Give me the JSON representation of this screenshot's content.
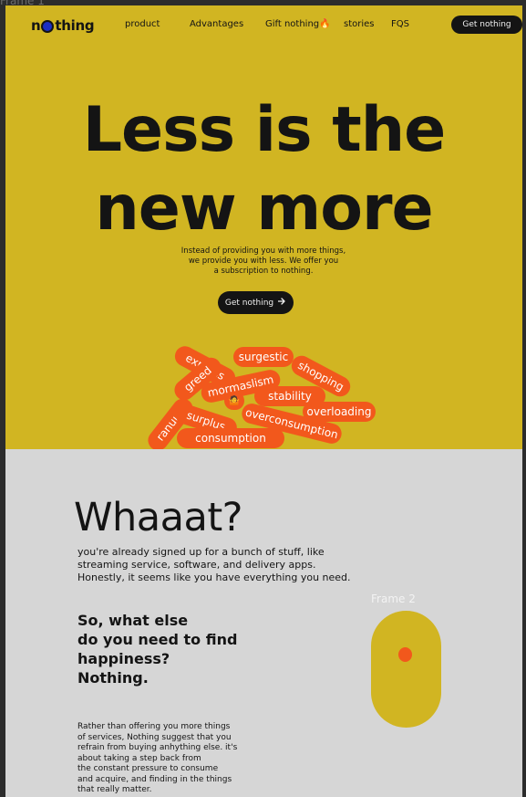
{
  "canvas": {
    "frame_label": "Frame 1"
  },
  "nav": {
    "logo": {
      "prefix": "n",
      "suffix": "thing"
    },
    "links": [
      "product",
      "Advantages",
      "Gift nothing🔥",
      "stories",
      "FQS"
    ],
    "cta": "Get nothing"
  },
  "hero": {
    "headline": [
      "Less is the",
      "new more"
    ],
    "subtext": [
      "Instead of providing you with more things,",
      "we provide you with less. We offer you",
      "a subscription to nothing."
    ],
    "cta": "Get nothing",
    "cta_icon": "arrow-right-icon",
    "tags": [
      "express",
      "surgestic",
      "greed",
      "mormaslism",
      "shopping",
      "stability",
      "surplus",
      "overloading",
      "ranuus",
      "overconsumption",
      "consumption",
      "🤷"
    ]
  },
  "section": {
    "title": "Whaaat?",
    "paragraph": [
      "you're already signed up for a bunch of stuff, like",
      "streaming service, software, and delivery apps.",
      "Honestly, it seems like you have everything you need."
    ],
    "question": [
      "So, what else",
      "do you need to find",
      "happiness?",
      "Nothing."
    ],
    "body": [
      "Rather than offering you more things",
      "of services, Nothing suggest that you",
      "refrain from buying anhything else. it's",
      "about taking a step back from",
      "the constant pressure to consume",
      "and acquire, and finding in the things",
      "that really matter."
    ],
    "frame2_label": "Frame 2"
  },
  "colors": {
    "hero_bg": "#d1b522",
    "section_bg": "#d6d6d6",
    "accent": "#f2581c",
    "dark": "#141414",
    "logo_dot": "#1c2fc4"
  }
}
